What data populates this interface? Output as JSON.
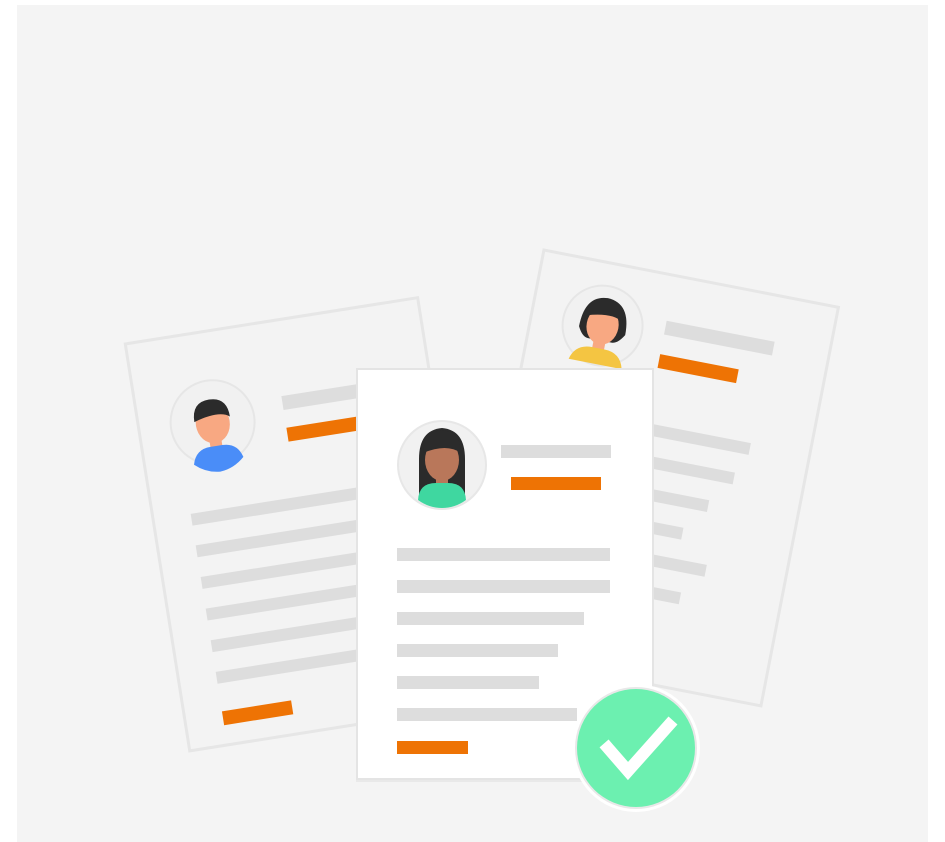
{
  "colors": {
    "panel_background": "#f4f4f4",
    "card_background": "#f3f3f3",
    "front_card_background": "#ffffff",
    "card_border": "#e4e4e4",
    "placeholder_line": "#dddddd",
    "accent_line": "#ee7304",
    "avatar_background": "#f1f1f1",
    "check_fill": "#6cf0b0",
    "check_ring": "#ffffff",
    "check_mark": "#ffffff"
  },
  "illustration": {
    "cards": [
      {
        "id": "left",
        "avatar": {
          "skin": "#f8a882",
          "hair": "#2b2b2b",
          "shirt": "#4a8df8"
        }
      },
      {
        "id": "right",
        "avatar": {
          "skin": "#f8a882",
          "hair": "#2b2b2b",
          "shirt": "#f4c542"
        }
      },
      {
        "id": "front",
        "avatar": {
          "skin": "#b9775a",
          "hair": "#2b2b2b",
          "shirt": "#3fd7a0"
        }
      }
    ],
    "badge_icon": "checkmark-icon"
  }
}
